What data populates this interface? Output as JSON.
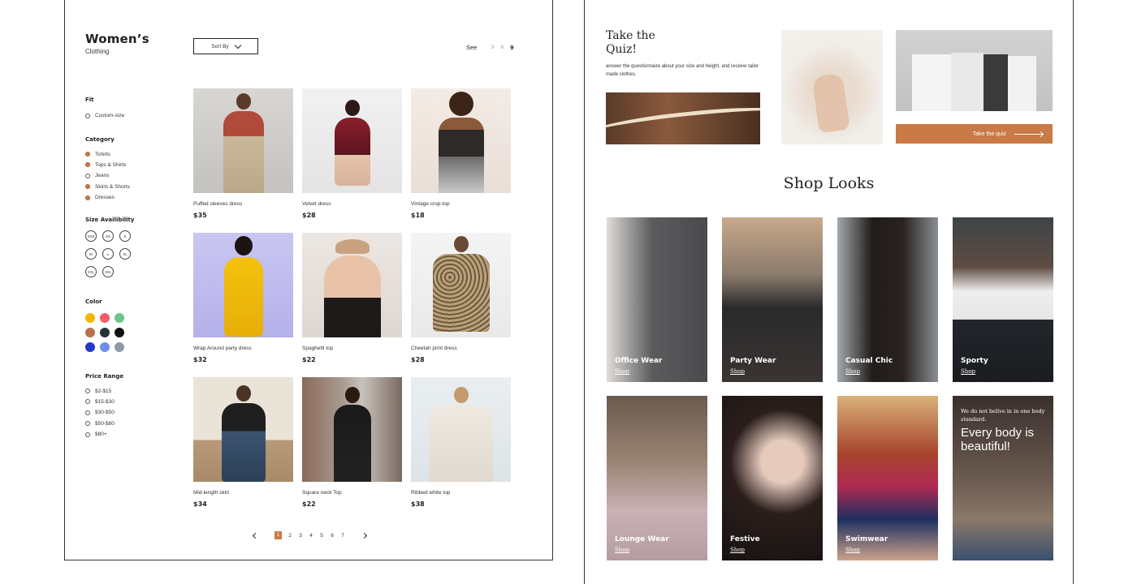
{
  "left": {
    "brand_title": "Women’s",
    "brand_sub": "Clothing",
    "sort_label": "Sort By",
    "see_label": "See",
    "see_options": [
      "3",
      "6",
      "9"
    ],
    "filters": {
      "fit": {
        "title": "Fit",
        "options": [
          "Custom-size"
        ]
      },
      "category": {
        "title": "Category",
        "options": [
          "Tshirts",
          "Tops & Shirts",
          "Jeans",
          "Skirts & Shorts",
          "Dresses"
        ]
      },
      "size": {
        "title": "Size Availibility",
        "options": [
          "2XS",
          "XS",
          "S",
          "M",
          "L",
          "XL",
          "2XL",
          "3XL"
        ]
      },
      "color": {
        "title": "Color",
        "swatches": [
          "#f2b705",
          "#f45b69",
          "#6cc58a",
          "#b7714a",
          "#263238",
          "#111111",
          "#2638c9",
          "#6f8de8",
          "#8e9aa8"
        ]
      },
      "price": {
        "title": "Price Range",
        "options": [
          "$2-$15",
          "$15-$30",
          "$30-$50",
          "$50-$80",
          "$80+"
        ]
      }
    },
    "products": [
      {
        "name": "Puffed sleeves dress",
        "price": "$35"
      },
      {
        "name": "Velvet dress",
        "price": "$28"
      },
      {
        "name": "Vintage crop-top",
        "price": "$18"
      },
      {
        "name": "Wrap Around party dress",
        "price": "$32"
      },
      {
        "name": "Spaghetti top",
        "price": "$22"
      },
      {
        "name": "Cheetah print dress",
        "price": "$28"
      },
      {
        "name": "Mid-length skirt",
        "price": "$34"
      },
      {
        "name": "Square neck Top",
        "price": "$22"
      },
      {
        "name": "Ribbed white top",
        "price": "$38"
      }
    ],
    "pages": [
      "1",
      "2",
      "3",
      "4",
      "5",
      "6",
      "7"
    ]
  },
  "right": {
    "quiz_title": "Take the Quiz!",
    "quiz_desc": "answer the questionnaire about your size and height, and receive tailor made clothes.",
    "quiz_button": "Take the quiz",
    "shop_title": "Shop Looks",
    "looks": [
      {
        "title": "Office Wear",
        "link": "Shop"
      },
      {
        "title": "Party Wear",
        "link": "Shop"
      },
      {
        "title": "Casual Chic",
        "link": "Shop"
      },
      {
        "title": "Sporty",
        "link": "Shop"
      },
      {
        "title": "Lounge Wear",
        "link": "Shop"
      },
      {
        "title": "Festive",
        "link": "Shop"
      },
      {
        "title": "Swimwear",
        "link": "Shop"
      }
    ],
    "manifesto_small": "We do not belive in in one body standard.",
    "manifesto_big": "Every body is beautiful!"
  },
  "theme": {
    "accent": "#c97a46"
  }
}
